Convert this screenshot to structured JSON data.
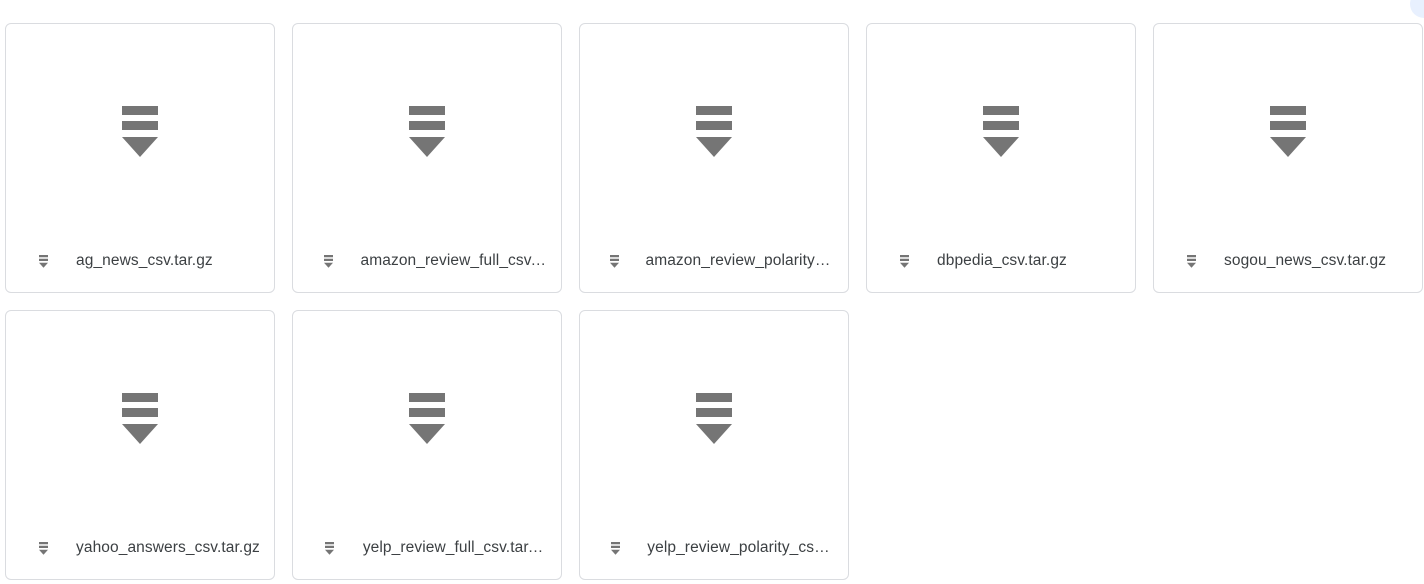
{
  "files": [
    {
      "name": "ag_news_csv.tar.gz",
      "icon": "archive-icon"
    },
    {
      "name": "amazon_review_full_csv.tar.gz",
      "icon": "archive-icon"
    },
    {
      "name": "amazon_review_polarity_csv.tar.gz",
      "icon": "archive-icon"
    },
    {
      "name": "dbpedia_csv.tar.gz",
      "icon": "archive-icon"
    },
    {
      "name": "sogou_news_csv.tar.gz",
      "icon": "archive-icon"
    },
    {
      "name": "yahoo_answers_csv.tar.gz",
      "icon": "archive-icon"
    },
    {
      "name": "yelp_review_full_csv.tar.gz",
      "icon": "archive-icon"
    },
    {
      "name": "yelp_review_polarity_csv.tar.gz",
      "icon": "archive-icon"
    }
  ],
  "colors": {
    "icon": "#757575",
    "text": "#3c4043",
    "border": "#dadce0"
  }
}
